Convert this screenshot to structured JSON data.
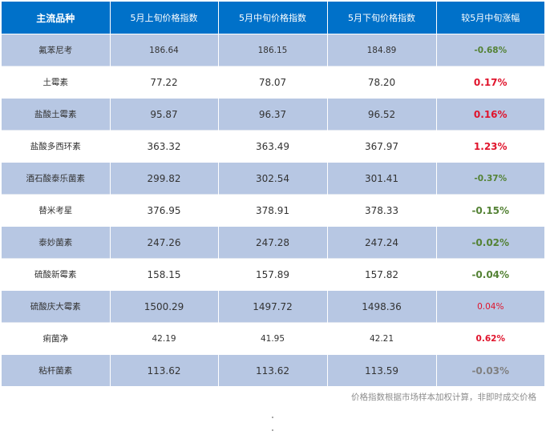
{
  "header": {
    "col_variety": "主流品种",
    "col_early": "5月上旬价格指数",
    "col_mid": "5月中旬价格指数",
    "col_late": "5月下旬价格指数",
    "col_change": "较5月中旬涨幅"
  },
  "rows": [
    {
      "name": "氟苯尼考",
      "early": "186.64",
      "mid": "186.15",
      "late": "184.89",
      "change": "-0.68%"
    },
    {
      "name": "土霉素",
      "early": "77.22",
      "mid": "78.07",
      "late": "78.20",
      "change": "0.17%"
    },
    {
      "name": "盐酸土霉素",
      "early": "95.87",
      "mid": "96.37",
      "late": "96.52",
      "change": "0.16%"
    },
    {
      "name": "盐酸多西环素",
      "early": "363.32",
      "mid": "363.49",
      "late": "367.97",
      "change": "1.23%"
    },
    {
      "name": "酒石酸泰乐菌素",
      "early": "299.82",
      "mid": "302.54",
      "late": "301.41",
      "change": "-0.37%"
    },
    {
      "name": "替米考星",
      "early": "376.95",
      "mid": "378.91",
      "late": "378.33",
      "change": "-0.15%"
    },
    {
      "name": "泰妙菌素",
      "early": "247.26",
      "mid": "247.28",
      "late": "247.24",
      "change": "-0.02%"
    },
    {
      "name": "硫酸新霉素",
      "early": "158.15",
      "mid": "157.89",
      "late": "157.82",
      "change": "-0.04%"
    },
    {
      "name": "硫酸庆大霉素",
      "early": "1500.29",
      "mid": "1497.72",
      "late": "1498.36",
      "change": "0.04%"
    },
    {
      "name": "痢菌净",
      "early": "42.19",
      "mid": "41.95",
      "late": "42.21",
      "change": "0.62%"
    },
    {
      "name": "粘杆菌素",
      "early": "113.62",
      "mid": "113.62",
      "late": "113.59",
      "change": "-0.03%"
    }
  ],
  "footer": {
    "note": "价格指数根据市场样本加权计算，非即时成交价格"
  },
  "colors": {
    "header_bg": "#0071c9",
    "row_alt_bg": "#b7c7e3",
    "negative": "#548235",
    "positive": "#e0142c",
    "flat": "#808080"
  }
}
